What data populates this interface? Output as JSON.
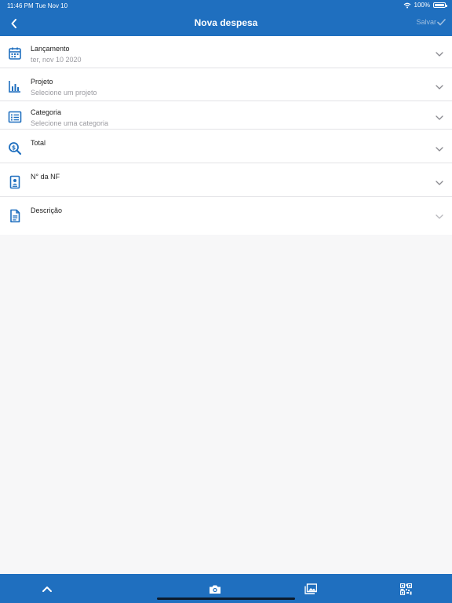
{
  "status_bar": {
    "time": "11:46 PM",
    "date": "Tue Nov 10",
    "battery": "100%"
  },
  "nav": {
    "title": "Nova despesa",
    "save_label": "Salvar"
  },
  "form": {
    "rows": [
      {
        "label": "Lançamento",
        "value": "ter, nov 10 2020",
        "icon": "calendar-icon"
      },
      {
        "label": "Projeto",
        "value": "Selecione um projeto",
        "icon": "bar-chart-icon"
      },
      {
        "label": "Categoria",
        "value": "Selecione uma categoria",
        "icon": "list-icon"
      },
      {
        "label": "Total",
        "value": "",
        "icon": "money-search-icon"
      },
      {
        "label": "N° da NF",
        "value": "",
        "icon": "badge-icon"
      },
      {
        "label": "Descrição",
        "value": "",
        "icon": "document-icon"
      }
    ]
  },
  "toolbar": {
    "items": [
      "chevron-up-icon",
      "camera-icon",
      "gallery-icon",
      "qr-code-icon"
    ]
  },
  "colors": {
    "primary": "#1f6fbf",
    "icon": "#1f6fbf",
    "label": "#222222",
    "placeholder": "#9a9aa0",
    "divider": "#e3e3e6"
  }
}
